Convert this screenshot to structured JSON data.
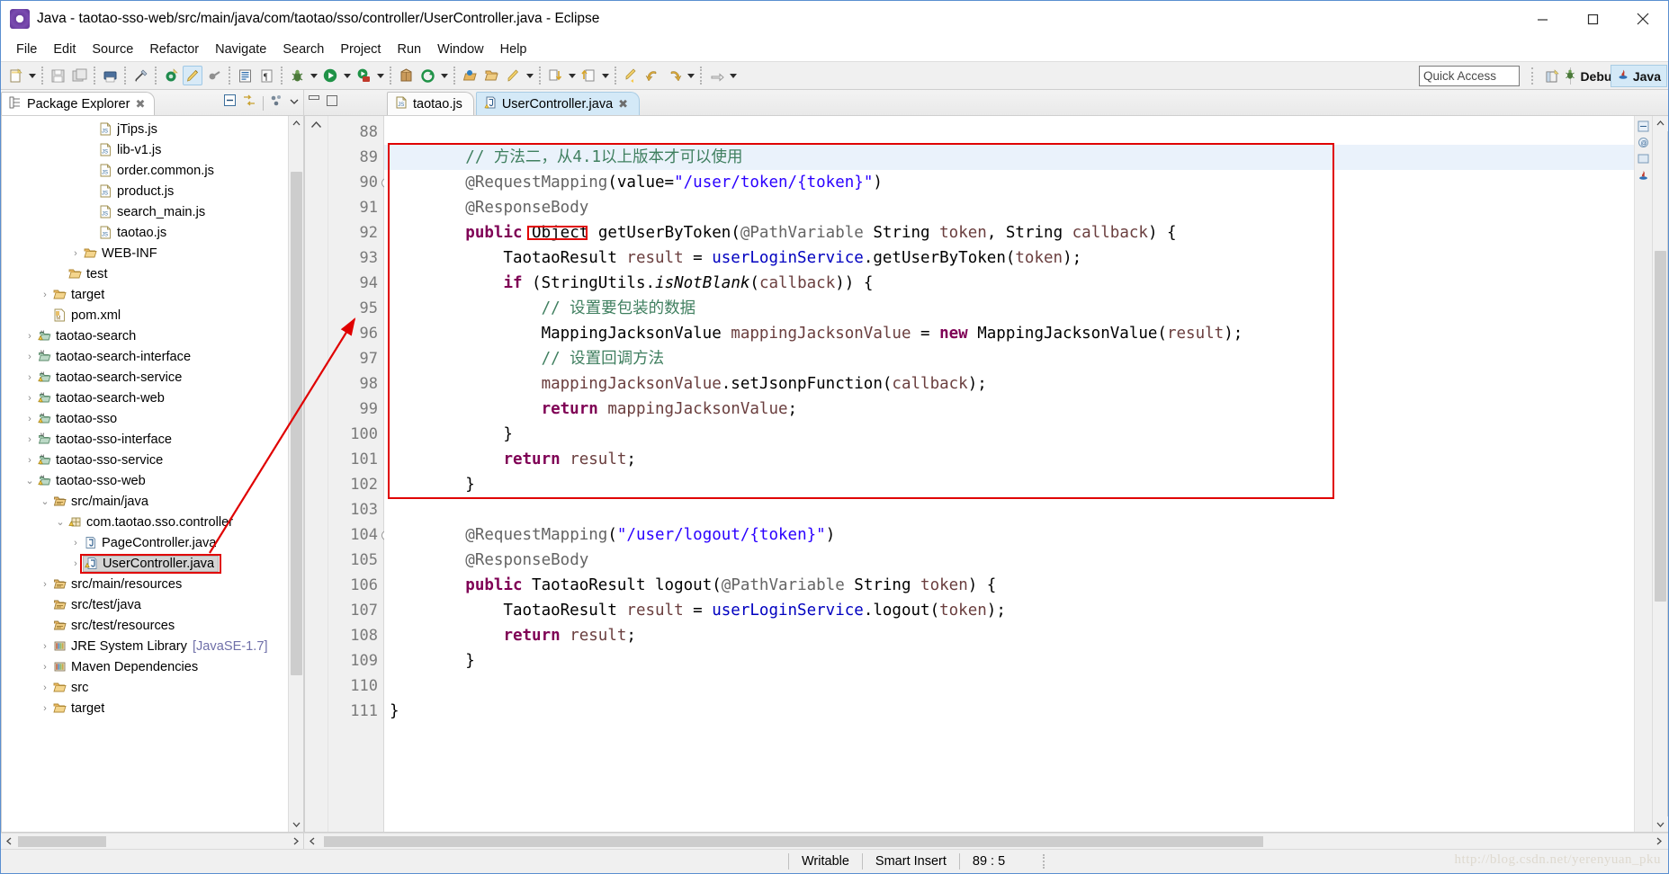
{
  "window": {
    "title": "Java - taotao-sso-web/src/main/java/com/taotao/sso/controller/UserController.java - Eclipse",
    "app_icon": "eclipse-icon",
    "minimize_label": "—",
    "maximize_label": "□",
    "close_label": "✕"
  },
  "menubar": {
    "items": [
      {
        "label": "File"
      },
      {
        "label": "Edit"
      },
      {
        "label": "Source"
      },
      {
        "label": "Refactor"
      },
      {
        "label": "Navigate"
      },
      {
        "label": "Search"
      },
      {
        "label": "Project"
      },
      {
        "label": "Run"
      },
      {
        "label": "Window"
      },
      {
        "label": "Help"
      }
    ]
  },
  "toolbar": {
    "quick_access_placeholder": "Quick Access",
    "perspectives": [
      {
        "label": "Debug",
        "icon": "debug-perspective-icon",
        "active": false
      },
      {
        "label": "Java",
        "icon": "java-perspective-icon",
        "active": true
      }
    ]
  },
  "explorer": {
    "tab_label": "Package Explorer",
    "tab_icon": "package-explorer-icon",
    "close_label": "✖",
    "actions": [
      "collapse-all-icon",
      "link-with-editor-icon",
      "view-menu-icon",
      "view-chevron-icon"
    ],
    "tree": [
      {
        "indent": 5,
        "twisty": "",
        "icon": "js-file-icon",
        "label": "jTips.js"
      },
      {
        "indent": 5,
        "twisty": "",
        "icon": "js-file-icon",
        "label": "lib-v1.js"
      },
      {
        "indent": 5,
        "twisty": "",
        "icon": "js-file-icon",
        "label": "order.common.js"
      },
      {
        "indent": 5,
        "twisty": "",
        "icon": "js-file-icon",
        "label": "product.js"
      },
      {
        "indent": 5,
        "twisty": "",
        "icon": "js-file-icon",
        "label": "search_main.js"
      },
      {
        "indent": 5,
        "twisty": "",
        "icon": "js-file-icon",
        "label": "taotao.js"
      },
      {
        "indent": 4,
        "twisty": "›",
        "icon": "folder-icon",
        "label": "WEB-INF"
      },
      {
        "indent": 3,
        "twisty": "",
        "icon": "folder-icon",
        "label": "test"
      },
      {
        "indent": 2,
        "twisty": "›",
        "icon": "folder-icon",
        "label": "target"
      },
      {
        "indent": 2,
        "twisty": "",
        "icon": "xml-file-icon",
        "label": "pom.xml"
      },
      {
        "indent": 1,
        "twisty": "›",
        "icon": "maven-project-warn-icon",
        "label": "taotao-search"
      },
      {
        "indent": 1,
        "twisty": "›",
        "icon": "maven-project-icon",
        "label": "taotao-search-interface"
      },
      {
        "indent": 1,
        "twisty": "›",
        "icon": "maven-project-warn-icon",
        "label": "taotao-search-service"
      },
      {
        "indent": 1,
        "twisty": "›",
        "icon": "maven-project-warn-icon",
        "label": "taotao-search-web"
      },
      {
        "indent": 1,
        "twisty": "›",
        "icon": "maven-project-warn-icon",
        "label": "taotao-sso"
      },
      {
        "indent": 1,
        "twisty": "›",
        "icon": "maven-project-icon",
        "label": "taotao-sso-interface"
      },
      {
        "indent": 1,
        "twisty": "›",
        "icon": "maven-project-warn-icon",
        "label": "taotao-sso-service"
      },
      {
        "indent": 1,
        "twisty": "⌄",
        "icon": "maven-project-warn-icon",
        "label": "taotao-sso-web"
      },
      {
        "indent": 2,
        "twisty": "⌄",
        "icon": "source-folder-icon",
        "label": "src/main/java"
      },
      {
        "indent": 3,
        "twisty": "⌄",
        "icon": "package-warn-icon",
        "label": "com.taotao.sso.controller"
      },
      {
        "indent": 4,
        "twisty": "›",
        "icon": "java-file-icon",
        "label": "PageController.java"
      },
      {
        "indent": 4,
        "twisty": "›",
        "icon": "java-file-warn-icon",
        "label": "UserController.java",
        "selected": true,
        "highlighted": true
      },
      {
        "indent": 2,
        "twisty": "›",
        "icon": "source-folder-icon",
        "label": "src/main/resources"
      },
      {
        "indent": 2,
        "twisty": "",
        "icon": "source-folder-icon",
        "label": "src/test/java"
      },
      {
        "indent": 2,
        "twisty": "",
        "icon": "source-folder-icon",
        "label": "src/test/resources"
      },
      {
        "indent": 2,
        "twisty": "›",
        "icon": "library-icon",
        "label": "JRE System Library",
        "suffix": "[JavaSE-1.7]"
      },
      {
        "indent": 2,
        "twisty": "›",
        "icon": "library-icon",
        "label": "Maven Dependencies"
      },
      {
        "indent": 2,
        "twisty": "›",
        "icon": "folder-icon",
        "label": "src"
      },
      {
        "indent": 2,
        "twisty": "›",
        "icon": "folder-icon",
        "label": "target"
      }
    ]
  },
  "editor": {
    "tabs": [
      {
        "label": "taotao.js",
        "icon": "js-file-icon",
        "active": false,
        "closable": false
      },
      {
        "label": "UserController.java",
        "icon": "java-file-warn-icon",
        "active": true,
        "closable": true,
        "close_label": "✖"
      }
    ],
    "first_line_number": 88,
    "lines": [
      {
        "num": "88",
        "fold": false,
        "highlight": false,
        "tokens": []
      },
      {
        "num": "89",
        "fold": false,
        "highlight": true,
        "tokens": [
          {
            "t": "        ",
            "c": "pln"
          },
          {
            "t": "// 方法二，从4.1以上版本才可以使用",
            "c": "cmt"
          }
        ]
      },
      {
        "num": "90",
        "fold": true,
        "highlight": false,
        "tokens": [
          {
            "t": "        ",
            "c": "pln"
          },
          {
            "t": "@RequestMapping",
            "c": "ann"
          },
          {
            "t": "(value=",
            "c": "pln"
          },
          {
            "t": "\"/user/token/{token}\"",
            "c": "str"
          },
          {
            "t": ")",
            "c": "pln"
          }
        ]
      },
      {
        "num": "91",
        "fold": false,
        "highlight": false,
        "tokens": [
          {
            "t": "        ",
            "c": "pln"
          },
          {
            "t": "@ResponseBody",
            "c": "ann"
          }
        ]
      },
      {
        "num": "92",
        "fold": false,
        "highlight": false,
        "tokens": [
          {
            "t": "        ",
            "c": "pln"
          },
          {
            "t": "public",
            "c": "k"
          },
          {
            "t": " Object",
            "c": "pln"
          },
          {
            "t": " getUserByToken(",
            "c": "pln"
          },
          {
            "t": "@PathVariable",
            "c": "ann"
          },
          {
            "t": " String ",
            "c": "pln"
          },
          {
            "t": "token",
            "c": "prm"
          },
          {
            "t": ", String ",
            "c": "pln"
          },
          {
            "t": "callback",
            "c": "prm"
          },
          {
            "t": ") {",
            "c": "pln"
          }
        ]
      },
      {
        "num": "93",
        "fold": false,
        "highlight": false,
        "tokens": [
          {
            "t": "            TaotaoResult ",
            "c": "pln"
          },
          {
            "t": "result",
            "c": "prm"
          },
          {
            "t": " = ",
            "c": "pln"
          },
          {
            "t": "userLoginService",
            "c": "fld"
          },
          {
            "t": ".getUserByToken(",
            "c": "pln"
          },
          {
            "t": "token",
            "c": "prm"
          },
          {
            "t": ");",
            "c": "pln"
          }
        ]
      },
      {
        "num": "94",
        "fold": false,
        "highlight": false,
        "tokens": [
          {
            "t": "            ",
            "c": "pln"
          },
          {
            "t": "if",
            "c": "k"
          },
          {
            "t": " (StringUtils.",
            "c": "pln"
          },
          {
            "t": "isNotBlank",
            "c": "sta"
          },
          {
            "t": "(",
            "c": "pln"
          },
          {
            "t": "callback",
            "c": "prm"
          },
          {
            "t": ")) {",
            "c": "pln"
          }
        ]
      },
      {
        "num": "95",
        "fold": false,
        "highlight": false,
        "tokens": [
          {
            "t": "                ",
            "c": "pln"
          },
          {
            "t": "// 设置要包装的数据",
            "c": "cmt"
          }
        ]
      },
      {
        "num": "96",
        "fold": false,
        "highlight": false,
        "tokens": [
          {
            "t": "                MappingJacksonValue ",
            "c": "pln"
          },
          {
            "t": "mappingJacksonValue",
            "c": "prm"
          },
          {
            "t": " = ",
            "c": "pln"
          },
          {
            "t": "new",
            "c": "k"
          },
          {
            "t": " MappingJacksonValue(",
            "c": "pln"
          },
          {
            "t": "result",
            "c": "prm"
          },
          {
            "t": ");",
            "c": "pln"
          }
        ]
      },
      {
        "num": "97",
        "fold": false,
        "highlight": false,
        "tokens": [
          {
            "t": "                ",
            "c": "pln"
          },
          {
            "t": "// 设置回调方法",
            "c": "cmt"
          }
        ]
      },
      {
        "num": "98",
        "fold": false,
        "highlight": false,
        "tokens": [
          {
            "t": "                ",
            "c": "pln"
          },
          {
            "t": "mappingJacksonValue",
            "c": "prm"
          },
          {
            "t": ".setJsonpFunction(",
            "c": "pln"
          },
          {
            "t": "callback",
            "c": "prm"
          },
          {
            "t": ");",
            "c": "pln"
          }
        ]
      },
      {
        "num": "99",
        "fold": false,
        "highlight": false,
        "tokens": [
          {
            "t": "                ",
            "c": "pln"
          },
          {
            "t": "return",
            "c": "k"
          },
          {
            "t": " ",
            "c": "pln"
          },
          {
            "t": "mappingJacksonValue",
            "c": "prm"
          },
          {
            "t": ";",
            "c": "pln"
          }
        ]
      },
      {
        "num": "100",
        "fold": false,
        "highlight": false,
        "tokens": [
          {
            "t": "            }",
            "c": "pln"
          }
        ]
      },
      {
        "num": "101",
        "fold": false,
        "highlight": false,
        "tokens": [
          {
            "t": "            ",
            "c": "pln"
          },
          {
            "t": "return",
            "c": "k"
          },
          {
            "t": " ",
            "c": "pln"
          },
          {
            "t": "result",
            "c": "prm"
          },
          {
            "t": ";",
            "c": "pln"
          }
        ]
      },
      {
        "num": "102",
        "fold": false,
        "highlight": false,
        "tokens": [
          {
            "t": "        }",
            "c": "pln"
          }
        ]
      },
      {
        "num": "103",
        "fold": false,
        "highlight": false,
        "tokens": []
      },
      {
        "num": "104",
        "fold": true,
        "highlight": false,
        "tokens": [
          {
            "t": "        ",
            "c": "pln"
          },
          {
            "t": "@RequestMapping",
            "c": "ann"
          },
          {
            "t": "(",
            "c": "pln"
          },
          {
            "t": "\"/user/logout/{token}\"",
            "c": "str"
          },
          {
            "t": ")",
            "c": "pln"
          }
        ]
      },
      {
        "num": "105",
        "fold": false,
        "highlight": false,
        "tokens": [
          {
            "t": "        ",
            "c": "pln"
          },
          {
            "t": "@ResponseBody",
            "c": "ann"
          }
        ]
      },
      {
        "num": "106",
        "fold": false,
        "highlight": false,
        "tokens": [
          {
            "t": "        ",
            "c": "pln"
          },
          {
            "t": "public",
            "c": "k"
          },
          {
            "t": " TaotaoResult logout(",
            "c": "pln"
          },
          {
            "t": "@PathVariable",
            "c": "ann"
          },
          {
            "t": " String ",
            "c": "pln"
          },
          {
            "t": "token",
            "c": "prm"
          },
          {
            "t": ") {",
            "c": "pln"
          }
        ]
      },
      {
        "num": "107",
        "fold": false,
        "highlight": false,
        "tokens": [
          {
            "t": "            TaotaoResult ",
            "c": "pln"
          },
          {
            "t": "result",
            "c": "prm"
          },
          {
            "t": " = ",
            "c": "pln"
          },
          {
            "t": "userLoginService",
            "c": "fld"
          },
          {
            "t": ".logout(",
            "c": "pln"
          },
          {
            "t": "token",
            "c": "prm"
          },
          {
            "t": ");",
            "c": "pln"
          }
        ]
      },
      {
        "num": "108",
        "fold": false,
        "highlight": false,
        "tokens": [
          {
            "t": "            ",
            "c": "pln"
          },
          {
            "t": "return",
            "c": "k"
          },
          {
            "t": " ",
            "c": "pln"
          },
          {
            "t": "result",
            "c": "prm"
          },
          {
            "t": ";",
            "c": "pln"
          }
        ]
      },
      {
        "num": "109",
        "fold": false,
        "highlight": false,
        "tokens": [
          {
            "t": "        }",
            "c": "pln"
          }
        ]
      },
      {
        "num": "110",
        "fold": false,
        "highlight": false,
        "tokens": []
      },
      {
        "num": "111",
        "fold": false,
        "highlight": false,
        "tokens": [
          {
            "t": "}",
            "c": "pln"
          }
        ]
      }
    ],
    "annotation": {
      "highlight_color": "#e00000",
      "boxed_type_token": "Object"
    }
  },
  "statusbar": {
    "writable": "Writable",
    "insert_mode": "Smart Insert",
    "cursor_position": "89 : 5",
    "watermark": "http://blog.csdn.net/yerenyuan_pku"
  }
}
